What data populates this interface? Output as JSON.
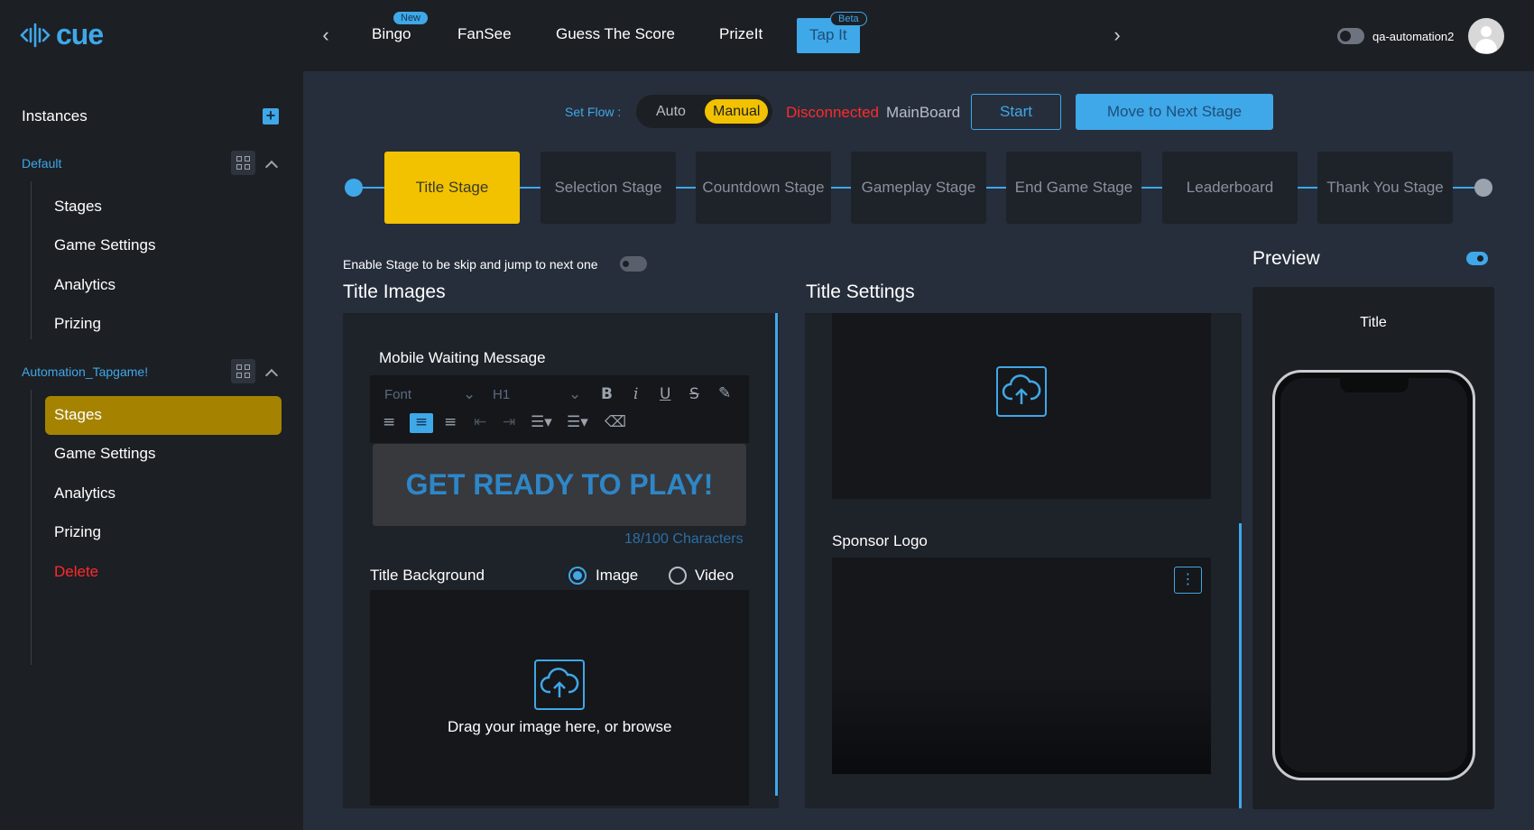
{
  "topbar": {
    "logo_text": "cue",
    "tabs": [
      {
        "label": "Bingo",
        "badge": "New"
      },
      {
        "label": "FanSee",
        "badge": ""
      },
      {
        "label": "Guess The Score",
        "badge": ""
      },
      {
        "label": "PrizeIt",
        "badge": ""
      },
      {
        "label": "Tap It",
        "badge": "Beta",
        "active": true
      }
    ],
    "username": "qa-automation2"
  },
  "sidebar": {
    "title": "Instances",
    "groups": [
      {
        "name": "Default",
        "items": [
          "Stages",
          "Game Settings",
          "Analytics",
          "Prizing"
        ]
      },
      {
        "name": "Automation_Tapgame!",
        "items": [
          "Stages",
          "Game Settings",
          "Analytics",
          "Prizing",
          "Delete"
        ],
        "active_item": "Stages"
      }
    ]
  },
  "flow": {
    "label": "Set Flow :",
    "options": [
      "Auto",
      "Manual"
    ],
    "selected": "Manual",
    "status": "Disconnected",
    "board": "MainBoard",
    "start_label": "Start",
    "next_label": "Move to Next Stage"
  },
  "stages": [
    "Title Stage",
    "Selection Stage",
    "Countdown Stage",
    "Gameplay Stage",
    "End Game Stage",
    "Leaderboard",
    "Thank You Stage"
  ],
  "active_stage": "Title Stage",
  "skip_label": "Enable Stage to be skip and jump to next one",
  "title_images": {
    "heading": "Title Images",
    "mobile_waiting_label": "Mobile Waiting Message",
    "font_placeholder": "Font",
    "heading_select": "H1",
    "editor_text": "GET READY TO PLAY!",
    "char_count": "18/100 Characters",
    "background_label": "Title Background",
    "radio_image": "Image",
    "radio_video": "Video",
    "upload_text": "Drag your image here, or browse"
  },
  "title_settings": {
    "heading": "Title Settings",
    "sponsor_label": "Sponsor Logo"
  },
  "preview": {
    "heading": "Preview",
    "title": "Title"
  },
  "colors": {
    "accent": "#3fa8e8",
    "active_stage": "#f2c200",
    "danger": "#ff2a2a",
    "sidebar_active": "#a58300"
  }
}
